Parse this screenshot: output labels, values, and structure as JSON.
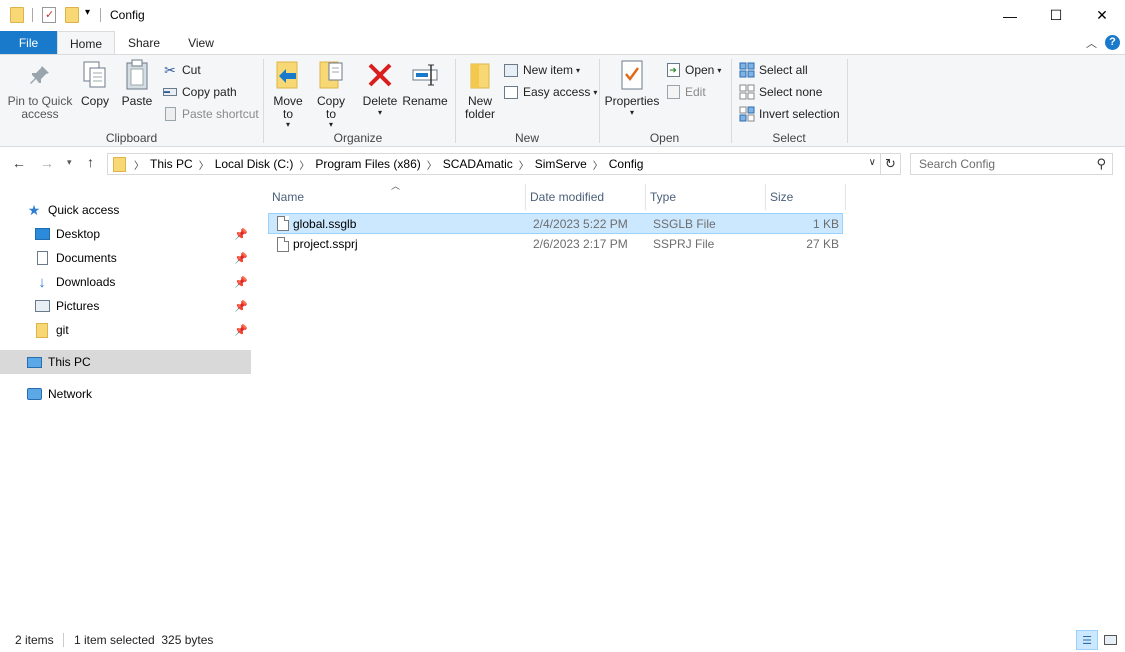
{
  "window": {
    "title": "Config",
    "minimize_glyph": "—",
    "maximize_glyph": "☐",
    "close_glyph": "✕"
  },
  "tabs": [
    "File",
    "Home",
    "Share",
    "View"
  ],
  "ribbon": {
    "clipboard": {
      "group_label": "Clipboard",
      "pin_to_quick_access": "Pin to Quick access",
      "copy": "Copy",
      "paste": "Paste",
      "cut": "Cut",
      "copy_path": "Copy path",
      "paste_shortcut": "Paste shortcut"
    },
    "organize": {
      "group_label": "Organize",
      "move_to": "Move to",
      "copy_to": "Copy to",
      "delete": "Delete",
      "rename": "Rename"
    },
    "new": {
      "group_label": "New",
      "new_folder": "New folder",
      "new_item": "New item",
      "easy_access": "Easy access"
    },
    "open": {
      "group_label": "Open",
      "properties": "Properties",
      "open": "Open",
      "edit": "Edit"
    },
    "select": {
      "group_label": "Select",
      "select_all": "Select all",
      "select_none": "Select none",
      "invert_selection": "Invert selection"
    }
  },
  "address": {
    "breadcrumbs": [
      "This PC",
      "Local Disk (C:)",
      "Program Files (x86)",
      "SCADAmatic",
      "SimServe",
      "Config"
    ],
    "search_placeholder": "Search Config"
  },
  "nav": {
    "quick_access": "Quick access",
    "pinned": [
      "Desktop",
      "Documents",
      "Downloads",
      "Pictures",
      "git"
    ],
    "this_pc": "This PC",
    "network": "Network"
  },
  "columns": {
    "name": "Name",
    "date_modified": "Date modified",
    "type": "Type",
    "size": "Size"
  },
  "files": [
    {
      "name": "global.ssglb",
      "date": "2/4/2023 5:22 PM",
      "type": "SSGLB File",
      "size": "1 KB",
      "selected": true
    },
    {
      "name": "project.ssprj",
      "date": "2/6/2023 2:17 PM",
      "type": "SSPRJ File",
      "size": "27 KB",
      "selected": false
    }
  ],
  "status": {
    "item_count": "2 items",
    "selection": "1 item selected  325 bytes"
  },
  "colors": {
    "accent": "#1979ca",
    "selection_bg": "#cce8ff",
    "selection_border": "#99d1ff",
    "nav_selected_bg": "#d9d9d9"
  }
}
